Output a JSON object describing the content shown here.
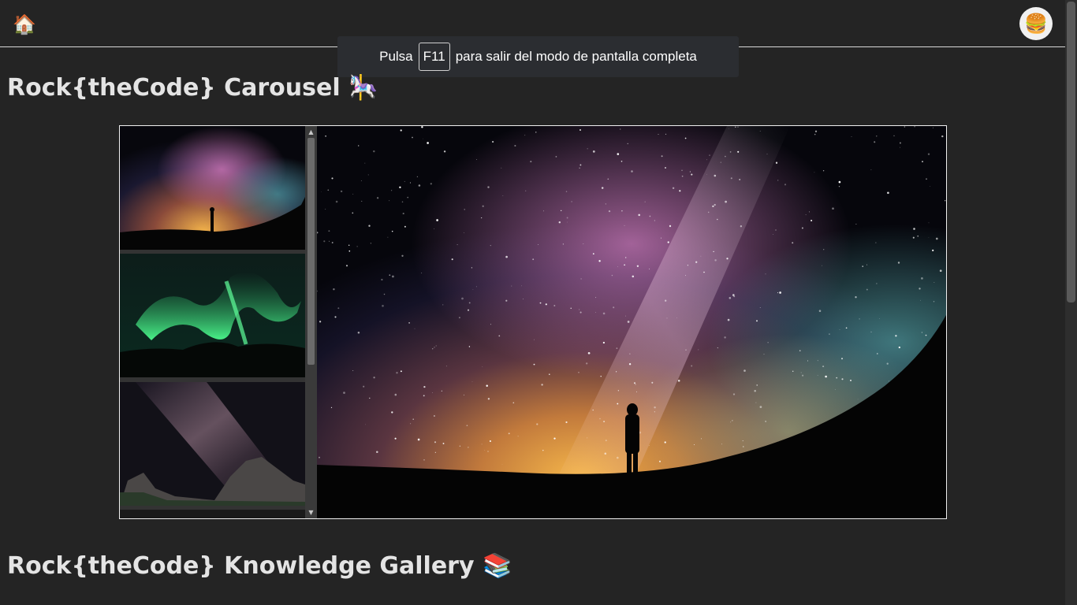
{
  "header": {
    "home_icon": "🏠",
    "menu_icon": "🍔"
  },
  "toast": {
    "before": "Pulsa",
    "key": "F11",
    "after": "para salir del modo de pantalla completa"
  },
  "carousel_section": {
    "title": "Rock{theCode} Carousel",
    "emoji": "🎠"
  },
  "gallery_section": {
    "title": "Rock{theCode} Knowledge Gallery",
    "emoji": "📚"
  },
  "carousel": {
    "thumbnails": [
      {
        "name": "milky-way-person"
      },
      {
        "name": "aurora-borealis"
      },
      {
        "name": "milky-way-rocks"
      }
    ],
    "selected": 0
  },
  "colors": {
    "background": "#242424",
    "text": "#e4e4e4",
    "toast": "#2b2d31"
  }
}
